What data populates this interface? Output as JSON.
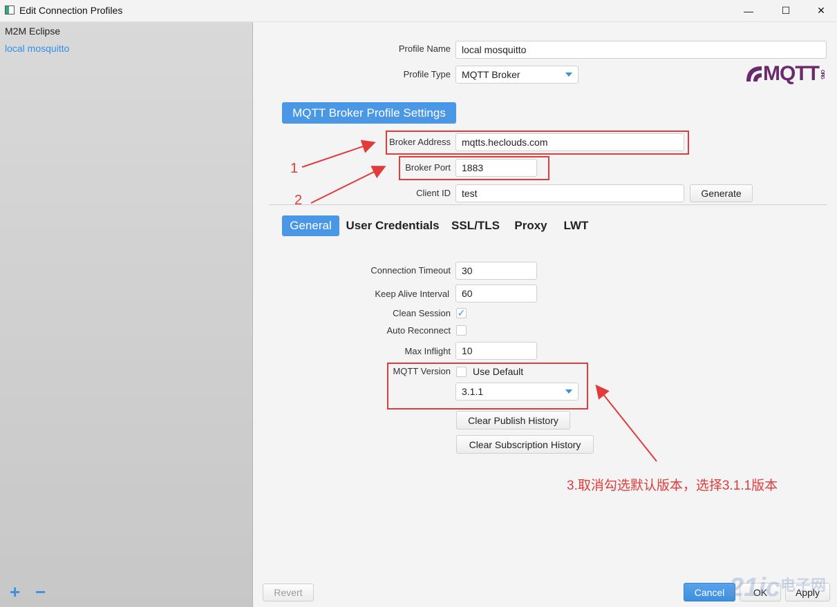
{
  "window": {
    "title": "Edit Connection Profiles",
    "minimize": "—",
    "maximize": "☐",
    "close": "✕"
  },
  "sidebar": {
    "items": [
      {
        "label": "M2M Eclipse"
      },
      {
        "label": "local mosquitto",
        "selected": true
      }
    ],
    "add_label": "+",
    "remove_label": "−"
  },
  "profile": {
    "name_label": "Profile Name",
    "name_value": "local mosquitto",
    "type_label": "Profile Type",
    "type_value": "MQTT Broker",
    "logo_text": "MQTT",
    "logo_small": "ORG"
  },
  "broker": {
    "section_title": "MQTT Broker Profile Settings",
    "address_label": "Broker Address",
    "address_value": "mqtts.heclouds.com",
    "port_label": "Broker Port",
    "port_value": "1883",
    "client_id_label": "Client ID",
    "client_id_value": "test",
    "generate_label": "Generate"
  },
  "tabs": [
    {
      "label": "General",
      "active": true
    },
    {
      "label": "User Credentials"
    },
    {
      "label": "SSL/TLS"
    },
    {
      "label": "Proxy"
    },
    {
      "label": "LWT"
    }
  ],
  "general": {
    "timeout_label": "Connection Timeout",
    "timeout_value": "30",
    "keepalive_label": "Keep Alive Interval",
    "keepalive_value": "60",
    "clean_session_label": "Clean Session",
    "clean_session_checked": true,
    "check_glyph": "✓",
    "auto_reconnect_label": "Auto Reconnect",
    "auto_reconnect_checked": false,
    "max_inflight_label": "Max Inflight",
    "max_inflight_value": "10",
    "mqtt_version_label": "MQTT Version",
    "use_default_label": "Use Default",
    "use_default_checked": false,
    "version_value": "3.1.1",
    "clear_publish_label": "Clear Publish History",
    "clear_subscription_label": "Clear Subscription History"
  },
  "annotations": {
    "num1": "1",
    "num2": "2",
    "step3": "3.取消勾选默认版本，选择3.1.1版本",
    "color": "#e23b3b"
  },
  "footer": {
    "revert_label": "Revert",
    "cancel_label": "Cancel",
    "ok_label": "OK",
    "apply_label": "Apply"
  },
  "watermark": {
    "text": "21ic",
    "cn": "电子网"
  },
  "colors": {
    "accent": "#4a97e6",
    "selected_text": "#2f8fe8",
    "annotation": "#e23b3b"
  }
}
